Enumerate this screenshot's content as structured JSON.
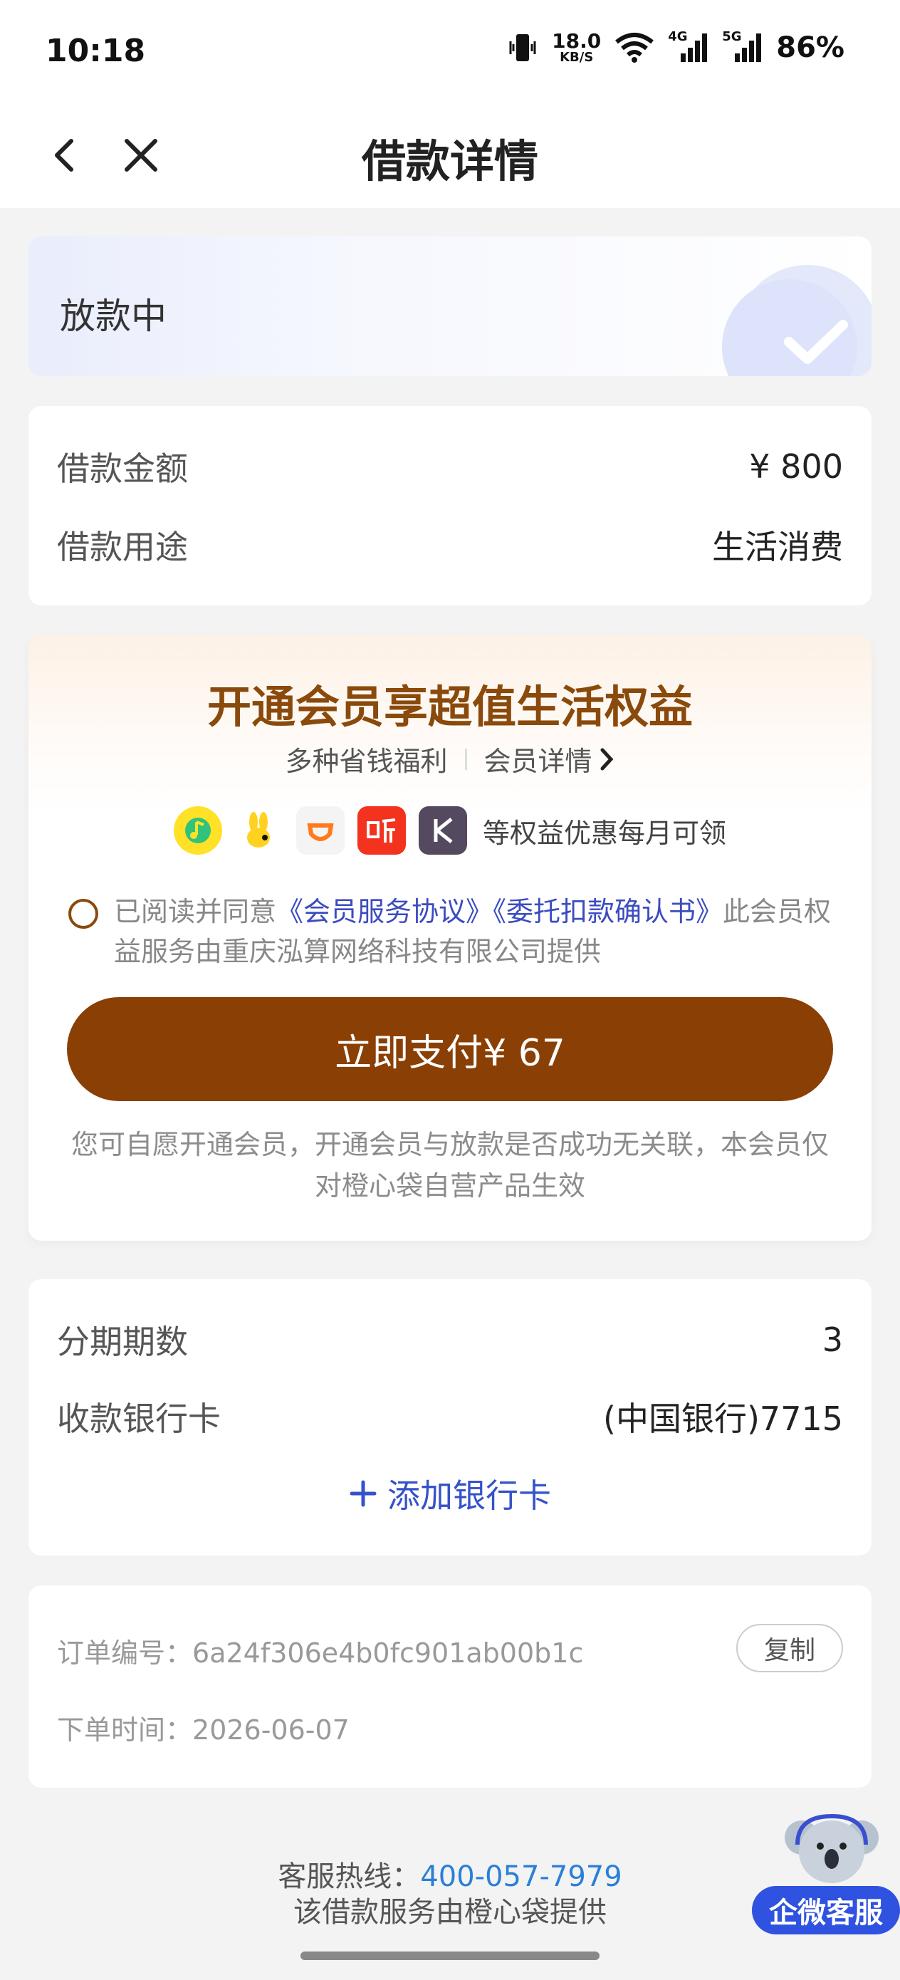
{
  "status_bar": {
    "time": "10:18",
    "net_speed_value": "18.0",
    "net_speed_unit": "KB/S",
    "signal1_label": "4G",
    "signal2_label": "5G",
    "battery": "86%"
  },
  "nav": {
    "title": "借款详情"
  },
  "status": {
    "label": "放款中"
  },
  "loan": {
    "amount_label": "借款金额",
    "amount_value": "¥ 800",
    "purpose_label": "借款用途",
    "purpose_value": "生活消费"
  },
  "membership": {
    "title": "开通会员享超值生活权益",
    "subtitle": "多种省钱福利",
    "detail_link": "会员详情",
    "benefits_text": "等权益优惠每月可领",
    "benefit_icons": [
      "qq-music-icon",
      "rabbit-icon",
      "didi-icon",
      "ting-icon",
      "k-icon"
    ],
    "agree_prefix": "已阅读并同意",
    "agreement_1": "《会员服务协议》",
    "agreement_2": "《委托扣款确认书》",
    "agree_suffix": "此会员权益服务由重庆泓算网络科技有限公司提供",
    "pay_button": "立即支付¥ 67",
    "note": "您可自愿开通会员，开通会员与放款是否成功无关联，本会员仅对橙心袋自营产品生效",
    "accent_color": "#8a3f04"
  },
  "installment": {
    "periods_label": "分期期数",
    "periods_value": "3",
    "bank_label": "收款银行卡",
    "bank_value": "(中国银行)7715",
    "add_card": "添加银行卡"
  },
  "order": {
    "number_label": "订单编号：",
    "number_value": "6a24f306e4b0fc901ab00b1c",
    "copy_button": "复制",
    "time_label": "下单时间：",
    "time_value": "2026-06-07"
  },
  "footer": {
    "hotline_label": "客服热线：",
    "hotline_number": "400-057-7979",
    "provider_text": "该借款服务由橙心袋提供"
  },
  "service": {
    "badge": "企微客服"
  }
}
